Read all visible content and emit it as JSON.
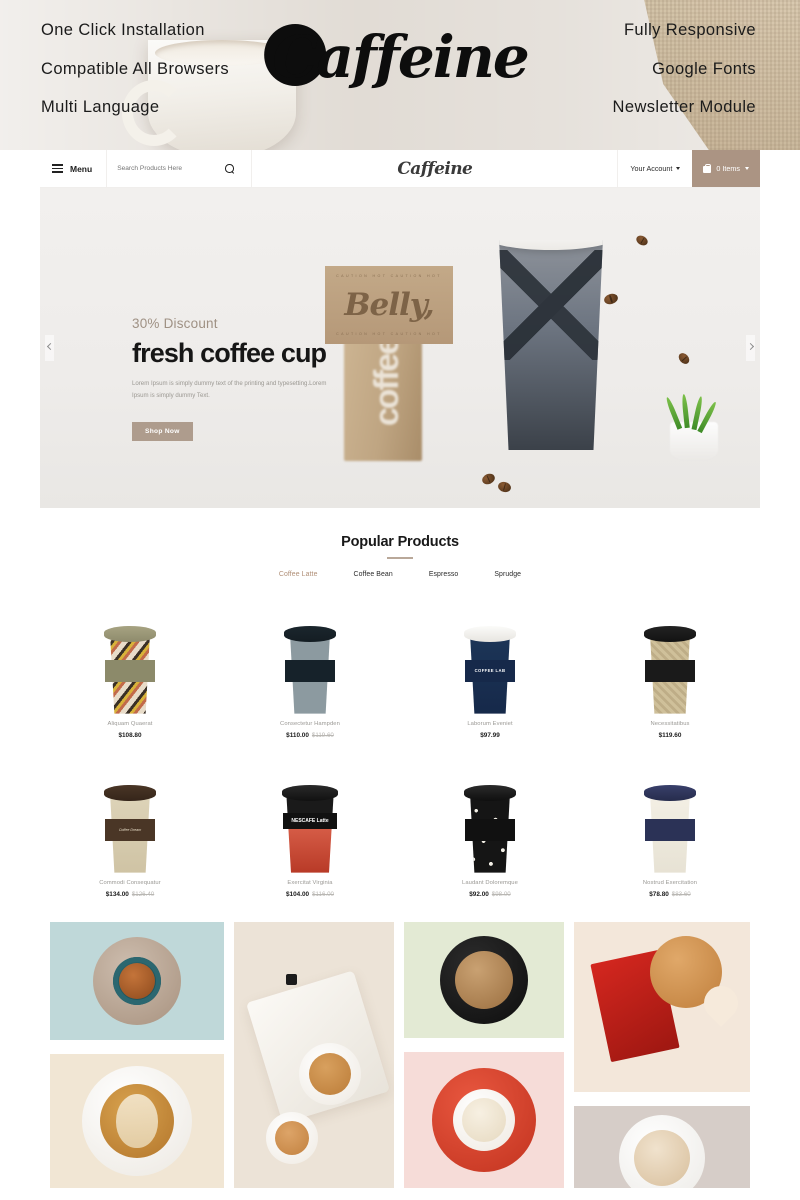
{
  "promo": {
    "left_items": [
      "One Click Installation",
      "Compatible All Browsers",
      "Multi Language"
    ],
    "right_items": [
      "Fully Responsive",
      "Google Fonts",
      "Newsletter Module"
    ],
    "logo": "Caffeine"
  },
  "site": {
    "header": {
      "menu_label": "Menu",
      "search_placeholder": "Search Products Here",
      "search_value": "",
      "logo": "Caffeine",
      "account_label": "Your Account",
      "cart_label": "0 Items"
    },
    "hero": {
      "discount": "30% Discount",
      "title": "fresh coffee cup",
      "subtitle": "Lorem Ipsum is simply dummy text of the printing and typesetting.Lorem Ipsum is simply dummy Text.",
      "button": "Shop Now",
      "cup_brand": "Belly,",
      "cup_caution": "CAUTION HOT     CAUTION HOT",
      "bag_label": "coffee"
    },
    "popular": {
      "title": "Popular Products",
      "tabs": [
        {
          "label": "Coffee Latte",
          "active": true
        },
        {
          "label": "Coffee Bean",
          "active": false
        },
        {
          "label": "Espresso",
          "active": false
        },
        {
          "label": "Sprudge",
          "active": false
        }
      ],
      "products": [
        {
          "name": "Aliquam Quaerat",
          "price": "$108.80",
          "old_price": "",
          "badge": ""
        },
        {
          "name": "Consectetur Hampden",
          "price": "$110.00",
          "old_price": "$119.60",
          "badge": ""
        },
        {
          "name": "Laborum Eveniet",
          "price": "$97.99",
          "old_price": "",
          "badge": "COFFEE LAB"
        },
        {
          "name": "Necessitatibus",
          "price": "$119.60",
          "old_price": "",
          "badge": ""
        },
        {
          "name": "Commodi Consequatur",
          "price": "$134.00",
          "old_price": "$126.40",
          "badge": "Coffee Dream"
        },
        {
          "name": "Exercitat Virginia",
          "price": "$104.00",
          "old_price": "$116.00",
          "badge": "NESCAFE Latte"
        },
        {
          "name": "Laudant Doloremque",
          "price": "$92.00",
          "old_price": "$98.00",
          "badge": ""
        },
        {
          "name": "Nostrud Exercitation",
          "price": "$78.80",
          "old_price": "$83.60",
          "badge": ""
        }
      ]
    },
    "gallery": {
      "tiles": [
        {
          "name": "teal-cup-saucer",
          "bg": "#bfd8d9"
        },
        {
          "name": "latte-art-coffee-beans",
          "bg": "#f1e6d4"
        },
        {
          "name": "laptop-two-lattes",
          "bg": "#ece3d7"
        },
        {
          "name": "black-cup-espresso",
          "bg": "#e3ead4"
        },
        {
          "name": "red-saucer-cappuccino",
          "bg": "#f6dcd8"
        },
        {
          "name": "red-book-heart-latte",
          "bg": "#f3e7da"
        },
        {
          "name": "dusted-cappuccino",
          "bg": "#d6cdc8"
        }
      ]
    }
  },
  "colors": {
    "accent": "#ab9483",
    "tab_active": "#b08f77",
    "hero_discount": "#9f9184",
    "text_dark": "#1c1c1c",
    "muted": "#9a9894"
  }
}
